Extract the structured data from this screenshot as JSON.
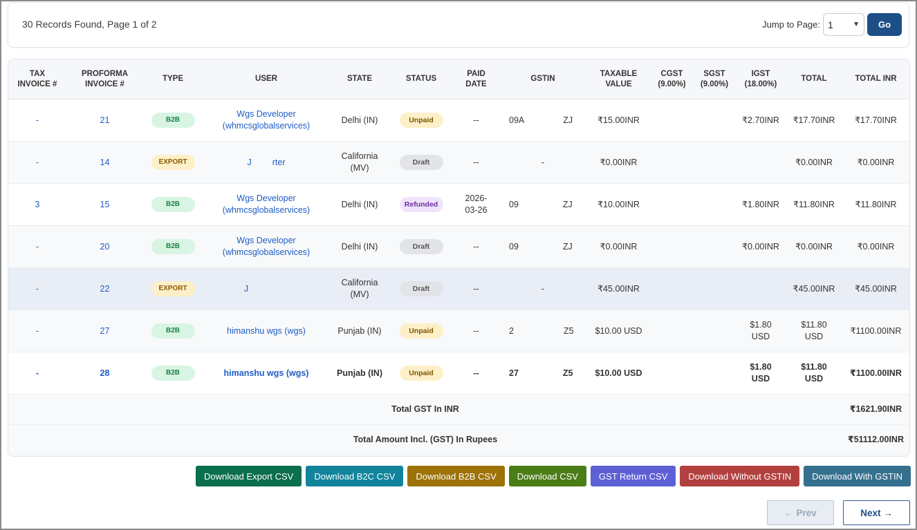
{
  "header": {
    "records_text": "30 Records Found, Page 1 of 2",
    "jump_label": "Jump to Page:",
    "page_select_value": "1",
    "go_label": "Go"
  },
  "table": {
    "columns": [
      {
        "line1": "TAX",
        "line2": "INVOICE #"
      },
      {
        "line1": "PROFORMA",
        "line2": "INVOICE #"
      },
      {
        "line1": "TYPE",
        "line2": ""
      },
      {
        "line1": "USER",
        "line2": ""
      },
      {
        "line1": "STATE",
        "line2": ""
      },
      {
        "line1": "STATUS",
        "line2": ""
      },
      {
        "line1": "PAID",
        "line2": "DATE"
      },
      {
        "line1": "GSTIN",
        "line2": ""
      },
      {
        "line1": "TAXABLE",
        "line2": "VALUE"
      },
      {
        "line1": "CGST",
        "line2": "(9.00%)"
      },
      {
        "line1": "SGST",
        "line2": "(9.00%)"
      },
      {
        "line1": "IGST",
        "line2": "(18.00%)"
      },
      {
        "line1": "TOTAL",
        "line2": ""
      },
      {
        "line1": "TOTAL INR",
        "line2": ""
      }
    ],
    "rows": [
      {
        "tax": "-",
        "proforma": "21",
        "type": "B2B",
        "user1": "Wgs Developer",
        "user2": "(whmcsglobalservices)",
        "state1": "Delhi (IN)",
        "state2": "",
        "status": "Unpaid",
        "paid1": "--",
        "paid2": "",
        "gstin": "09A",
        "gstin_end": "ZJ",
        "taxable": "₹15.00INR",
        "cgst": "",
        "sgst": "",
        "igst1": "₹2.70INR",
        "igst2": "",
        "total1": "₹17.70INR",
        "total2": "",
        "total_inr": "₹17.70INR"
      },
      {
        "tax": "-",
        "proforma": "14",
        "type": "EXPORT",
        "user1": "J",
        "user2": "rter",
        "state1": "California",
        "state2": "(MV)",
        "status": "Draft",
        "paid1": "--",
        "paid2": "",
        "gstin": "-",
        "gstin_end": "",
        "taxable": "₹0.00INR",
        "cgst": "",
        "sgst": "",
        "igst1": "",
        "igst2": "",
        "total1": "₹0.00INR",
        "total2": "",
        "total_inr": "₹0.00INR"
      },
      {
        "tax": "3",
        "proforma": "15",
        "type": "B2B",
        "user1": "Wgs Developer",
        "user2": "(whmcsglobalservices)",
        "state1": "Delhi (IN)",
        "state2": "",
        "status": "Refunded",
        "paid1": "2026-",
        "paid2": "03-26",
        "gstin": "09",
        "gstin_end": "ZJ",
        "taxable": "₹10.00INR",
        "cgst": "",
        "sgst": "",
        "igst1": "₹1.80INR",
        "igst2": "",
        "total1": "₹11.80INR",
        "total2": "",
        "total_inr": "₹11.80INR"
      },
      {
        "tax": "-",
        "proforma": "20",
        "type": "B2B",
        "user1": "Wgs Developer",
        "user2": "(whmcsglobalservices)",
        "state1": "Delhi (IN)",
        "state2": "",
        "status": "Draft",
        "paid1": "--",
        "paid2": "",
        "gstin": "09",
        "gstin_end": "ZJ",
        "taxable": "₹0.00INR",
        "cgst": "",
        "sgst": "",
        "igst1": "₹0.00INR",
        "igst2": "",
        "total1": "₹0.00INR",
        "total2": "",
        "total_inr": "₹0.00INR"
      },
      {
        "tax": "-",
        "proforma": "22",
        "type": "EXPORT",
        "user1": "J",
        "user2": "",
        "state1": "California",
        "state2": "(MV)",
        "status": "Draft",
        "paid1": "--",
        "paid2": "",
        "gstin": "-",
        "gstin_end": "",
        "taxable": "₹45.00INR",
        "cgst": "",
        "sgst": "",
        "igst1": "",
        "igst2": "",
        "total1": "₹45.00INR",
        "total2": "",
        "total_inr": "₹45.00INR"
      },
      {
        "tax": "-",
        "proforma": "27",
        "type": "B2B",
        "user1": "himanshu wgs (wgs)",
        "user2": "",
        "state1": "Punjab (IN)",
        "state2": "",
        "status": "Unpaid",
        "paid1": "--",
        "paid2": "",
        "gstin": "2",
        "gstin_end": "Z5",
        "taxable": "$10.00 USD",
        "cgst": "",
        "sgst": "",
        "igst1": "$1.80",
        "igst2": "USD",
        "total1": "$11.80",
        "total2": "USD",
        "total_inr": "₹1100.00INR"
      },
      {
        "tax": "-",
        "proforma": "28",
        "type": "B2B",
        "user1": "himanshu wgs (wgs)",
        "user2": "",
        "state1": "Punjab (IN)",
        "state2": "",
        "status": "Unpaid",
        "paid1": "--",
        "paid2": "",
        "gstin": "27",
        "gstin_end": "Z5",
        "taxable": "$10.00 USD",
        "cgst": "",
        "sgst": "",
        "igst1": "$1.80",
        "igst2": "USD",
        "total1": "$11.80",
        "total2": "USD",
        "total_inr": "₹1100.00INR"
      }
    ],
    "summary": [
      {
        "label": "Total GST In INR",
        "value": "₹1621.90INR"
      },
      {
        "label": "Total Amount Incl. (GST) In Rupees",
        "value": "₹51112.00INR"
      }
    ]
  },
  "downloads": [
    {
      "label": "Download Export CSV",
      "color": "#0b6e4f"
    },
    {
      "label": "Download B2C CSV",
      "color": "#11849c"
    },
    {
      "label": "Download B2B CSV",
      "color": "#9c7209"
    },
    {
      "label": "Download CSV",
      "color": "#4b7d17"
    },
    {
      "label": "GST Return CSV",
      "color": "#5e61d6"
    },
    {
      "label": "Download Without GSTIN",
      "color": "#b2403f"
    },
    {
      "label": "Download With GSTIN",
      "color": "#36708f"
    }
  ],
  "pager": {
    "prev": "← Prev",
    "next": "Next →"
  }
}
